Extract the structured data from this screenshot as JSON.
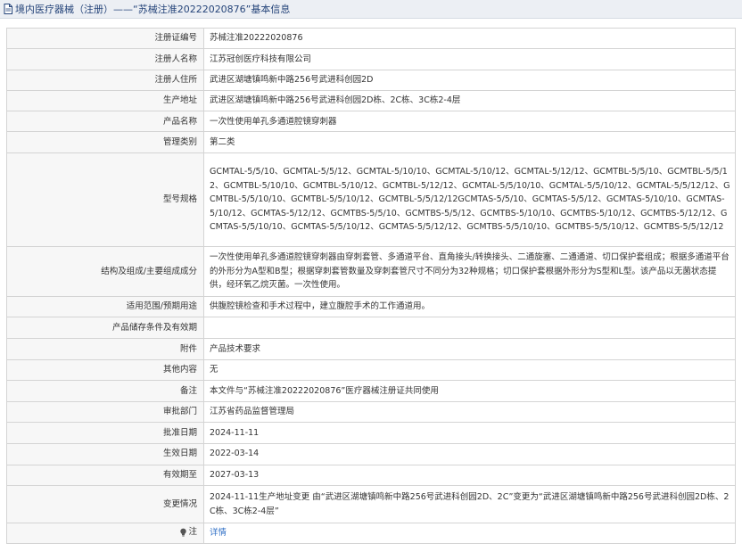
{
  "header": {
    "title": "境内医疗器械（注册）——“苏械注准20222020876”基本信息",
    "icon": "document-icon"
  },
  "rows": [
    {
      "label": "注册证编号",
      "value": "苏械注准20222020876"
    },
    {
      "label": "注册人名称",
      "value": "江苏冠创医疗科技有限公司"
    },
    {
      "label": "注册人住所",
      "value": "武进区湖塘镇鸣新中路256号武进科创园2D"
    },
    {
      "label": "生产地址",
      "value": "武进区湖塘镇鸣新中路256号武进科创园2D栋、2C栋、3C栋2-4层"
    },
    {
      "label": "产品名称",
      "value": "一次性使用单孔多通道腔镜穿刺器"
    },
    {
      "label": "管理类别",
      "value": "第二类"
    },
    {
      "label": "型号规格",
      "value": "GCMTAL-5/5/10、GCMTAL-5/5/12、GCMTAL-5/10/10、GCMTAL-5/10/12、GCMTAL-5/12/12、GCMTBL-5/5/10、GCMTBL-5/5/12、GCMTBL-5/10/10、GCMTBL-5/10/12、GCMTBL-5/12/12、GCMTAL-5/5/10/10、GCMTAL-5/5/10/12、GCMTAL-5/5/12/12、GCMTBL-5/5/10/10、GCMTBL-5/5/10/12、GCMTBL-5/5/12/12GCMTAS-5/5/10、GCMTAS-5/5/12、GCMTAS-5/10/10、GCMTAS-5/10/12、GCMTAS-5/12/12、GCMTBS-5/5/10、GCMTBS-5/5/12、GCMTBS-5/10/10、GCMTBS-5/10/12、GCMTBS-5/12/12、GCMTAS-5/5/10/10、GCMTAS-5/5/10/12、GCMTAS-5/5/12/12、GCMTBS-5/5/10/10、GCMTBS-5/5/10/12、GCMTBS-5/5/12/12"
    },
    {
      "label": "结构及组成/主要组成成分",
      "value": "一次性使用单孔多通道腔镜穿刺器由穿刺套管、多通道平台、直角接头/转换接头、二通旋塞、二通通道、切口保护套组成；根据多通道平台的外形分为A型和B型；根据穿刺套管数量及穿刺套管尺寸不同分为32种规格；切口保护套根据外形分为S型和L型。该产品以无菌状态提供，经环氧乙烷灭菌。一次性使用。"
    },
    {
      "label": "适用范围/预期用途",
      "value": "供腹腔镜检查和手术过程中，建立腹腔手术的工作通道用。"
    },
    {
      "label": "产品储存条件及有效期",
      "value": ""
    },
    {
      "label": "附件",
      "value": "产品技术要求"
    },
    {
      "label": "其他内容",
      "value": "无"
    },
    {
      "label": "备注",
      "value": "本文件与“苏械注准20222020876”医疗器械注册证共同使用"
    },
    {
      "label": "审批部门",
      "value": "江苏省药品监督管理局"
    },
    {
      "label": "批准日期",
      "value": "2024-11-11"
    },
    {
      "label": "生效日期",
      "value": "2022-03-14"
    },
    {
      "label": "有效期至",
      "value": "2027-03-13"
    },
    {
      "label": "变更情况",
      "value": "2024-11-11生产地址变更 由“武进区湖塘镇鸣新中路256号武进科创园2D、2C”变更为“武进区湖塘镇鸣新中路256号武进科创园2D栋、2C栋、3C栋2-4层”"
    }
  ],
  "note": {
    "label": "注",
    "icon": "lightbulb-icon",
    "link": "详情"
  },
  "colors": {
    "link": "#2f6fc6",
    "header_bg": "#eceff4",
    "header_text": "#26457a",
    "border": "#d4d4d4"
  }
}
